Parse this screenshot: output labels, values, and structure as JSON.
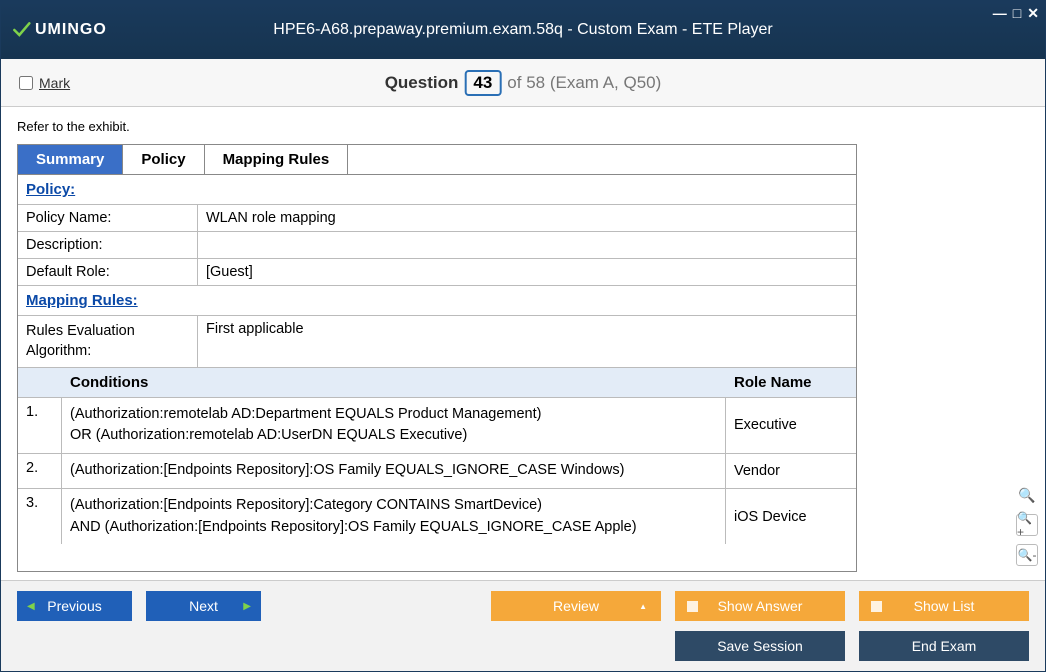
{
  "window": {
    "title": "HPE6-A68.prepaway.premium.exam.58q - Custom Exam - ETE Player",
    "logo_text": "UMINGO"
  },
  "header": {
    "mark_label": "Mark",
    "question_label": "Question",
    "current_num": "43",
    "total_text": "of 58 (Exam A, Q50)"
  },
  "content": {
    "intro": "Refer to the exhibit.",
    "tabs": [
      "Summary",
      "Policy",
      "Mapping Rules"
    ],
    "active_tab": 0,
    "policy_section": "Policy:",
    "policy_rows": [
      {
        "label": "Policy Name:",
        "value": "WLAN role mapping"
      },
      {
        "label": "Description:",
        "value": ""
      },
      {
        "label": "Default Role:",
        "value": "[Guest]"
      }
    ],
    "mapping_section": "Mapping Rules:",
    "mapping_rows": [
      {
        "label": "Rules Evaluation Algorithm:",
        "value": "First applicable"
      }
    ],
    "table_headers": {
      "conditions": "Conditions",
      "role": "Role Name"
    },
    "rules": [
      {
        "n": "1.",
        "cond": "(Authorization:remotelab AD:Department EQUALS Product Management)\nOR (Authorization:remotelab AD:UserDN EQUALS Executive)",
        "role": "Executive"
      },
      {
        "n": "2.",
        "cond": "(Authorization:[Endpoints Repository]:OS Family EQUALS_IGNORE_CASE Windows)",
        "role": "Vendor"
      },
      {
        "n": "3.",
        "cond": "(Authorization:[Endpoints Repository]:Category CONTAINS SmartDevice)\nAND (Authorization:[Endpoints Repository]:OS Family EQUALS_IGNORE_CASE Apple)",
        "role": "iOS Device"
      }
    ]
  },
  "footer": {
    "previous": "Previous",
    "next": "Next",
    "review": "Review",
    "show_answer": "Show Answer",
    "show_list": "Show List",
    "save_session": "Save Session",
    "end_exam": "End Exam"
  }
}
